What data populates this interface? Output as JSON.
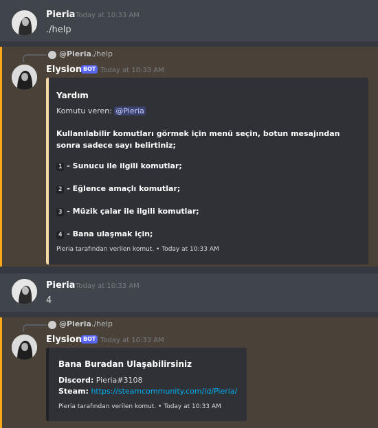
{
  "messages": [
    {
      "username": "Pieria",
      "timestamp": "Today at 10:33 AM",
      "content": "./help"
    },
    {
      "reply": {
        "username": "@Pieria",
        "content": "./help"
      },
      "username": "Elysion",
      "badge": "BOT",
      "timestamp": "Today at 10:33 AM",
      "embed": {
        "title": "Yardım",
        "requested_label": "Komutu veren:",
        "mention": "@Pieria",
        "description": "Kullanılabilir komutları görmek için menü seçin, botun mesajından sonra sadece sayı belirtiniz;",
        "items": [
          {
            "num": "1",
            "text": "- Sunucu ile ilgili komutlar;"
          },
          {
            "num": "2",
            "text": "- Eğlence amaçlı komutlar;"
          },
          {
            "num": "3",
            "text": "- Müzik çalar ile ilgili komutlar;"
          },
          {
            "num": "4",
            "text": "- Bana ulaşmak için;"
          }
        ],
        "footer": "Pieria tarafından verilen komut. • Today at 10:33 AM"
      }
    },
    {
      "username": "Pieria",
      "timestamp": "Today at 10:33 AM",
      "content": "4"
    },
    {
      "reply": {
        "username": "@Pieria",
        "content": "./help"
      },
      "username": "Elysion",
      "badge": "BOT",
      "timestamp": "Today at 10:33 AM",
      "embed": {
        "title": "Bana Buradan Ulaşabilirsiniz",
        "discord_label": "Discord:",
        "discord_value": "Pieria#3108",
        "steam_label": "Steam:",
        "steam_value": "https://steamcommunity.com/id/Pieria/",
        "footer": "Pieria tarafından verilen komut. • Today at 10:33 AM"
      }
    }
  ],
  "colors": {
    "background": "#36393f",
    "highlight": "#4a4238",
    "highlight_border": "#faa81a",
    "bot_badge": "#5865f2",
    "link": "#00aff4"
  }
}
